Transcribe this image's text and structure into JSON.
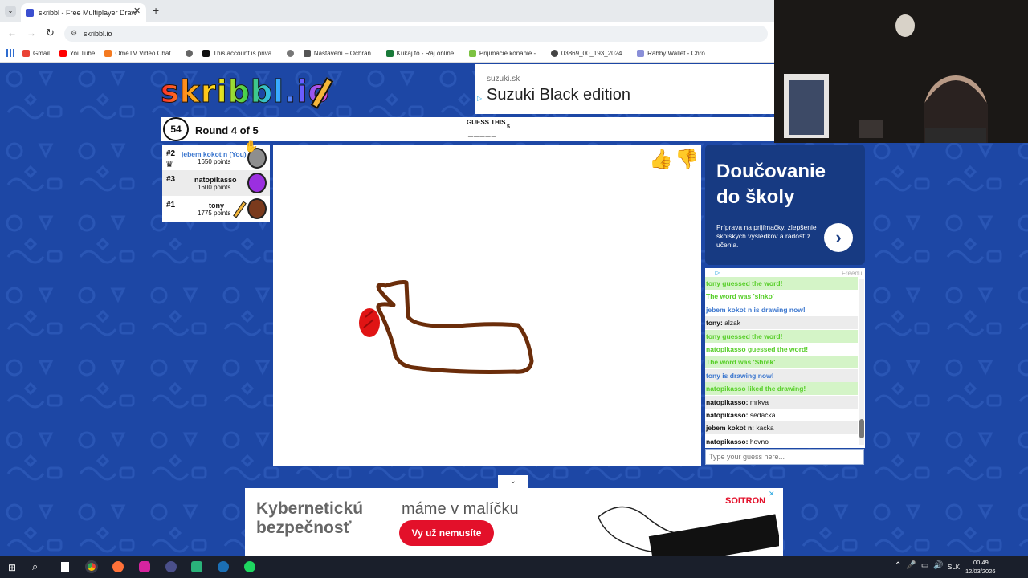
{
  "browser": {
    "tab_title": "skribbl - Free Multiplayer Draw",
    "url": "skribbl.io",
    "bookmarks": [
      "Gmail",
      "YouTube",
      "OmeTV Video Chat...",
      "This account is priva...",
      "Nastavení – Ochran...",
      "Kukaj.to - Raj online...",
      "Prijímacie konanie -...",
      "03869_00_193_2024...",
      "Rabby Wallet - Chro..."
    ]
  },
  "colors": {
    "page_bg": "#1d47a5",
    "chat_green": "#56ce27",
    "chat_blue": "#3975ce",
    "drawing_brown": "#6b2d0a",
    "drawing_red": "#e01414"
  },
  "game": {
    "logo": "skribbl.io",
    "timer": "54",
    "round": "Round 4 of 5",
    "hint_label": "GUESS THIS",
    "hint_count": "5",
    "hint_blanks": "_ _ _ _ _"
  },
  "players": [
    {
      "rank": "#2",
      "name": "jebem kokot n (You)",
      "points": "1650 points",
      "self": true
    },
    {
      "rank": "#3",
      "name": "natopikasso",
      "points": "1600 points"
    },
    {
      "rank": "#1",
      "name": "tony",
      "points": "1775 points"
    }
  ],
  "chat": {
    "messages": [
      {
        "text": "tony guessed the word!",
        "type": "green"
      },
      {
        "text": "The word was 'slnko'",
        "type": "green"
      },
      {
        "text": "jebem kokot n is drawing now!",
        "type": "blue"
      },
      {
        "name": "tony:",
        "text": "alzak",
        "type": "chat"
      },
      {
        "text": "tony guessed the word!",
        "type": "green"
      },
      {
        "text": "natopikasso guessed the word!",
        "type": "green"
      },
      {
        "text": "The word was 'Shrek'",
        "type": "green"
      },
      {
        "text": "tony is drawing now!",
        "type": "blue"
      },
      {
        "text": "natopikasso liked the drawing!",
        "type": "green"
      },
      {
        "name": "natopikasso:",
        "text": "mrkva",
        "type": "chat"
      },
      {
        "name": "natopikasso:",
        "text": "sedačka",
        "type": "chat"
      },
      {
        "name": "jebem kokot n:",
        "text": "kacka",
        "type": "chat"
      },
      {
        "name": "natopikasso:",
        "text": "hovno",
        "type": "chat"
      }
    ],
    "input_placeholder": "Type your guess here..."
  },
  "ads": {
    "top_domain": "suzuki.sk",
    "top_title": "Suzuki Black edition",
    "side_title": "Doučovanie do školy",
    "side_text": "Príprava na prijímačky, zlepšenie školských výsledkov a radosť z učenia.",
    "side_brand": "Freedu",
    "bottom_headline": "Kybernetickú bezpečnosť",
    "bottom_tagline": "máme v malíčku",
    "bottom_button": "Vy už nemusíte",
    "bottom_brand": "SOITRON"
  },
  "taskbar": {
    "lang": "SLK",
    "time": "00:49",
    "date": "12/03/2026"
  }
}
